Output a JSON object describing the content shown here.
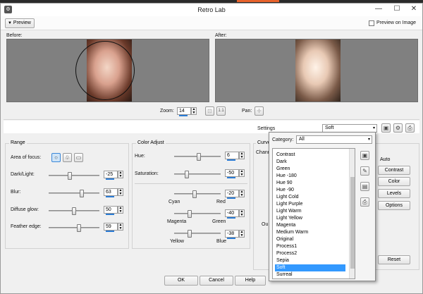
{
  "window": {
    "title": "Retro Lab",
    "app_label": "VZ",
    "close_glyph": "✕",
    "min_glyph": "—",
    "max_glyph": "☐"
  },
  "toolbar": {
    "preview_label": "Preview",
    "preview_on_image": "Preview on Image"
  },
  "preview": {
    "before_label": "Before:",
    "after_label": "After:",
    "zoom_label": "Zoom:",
    "zoom_value": "14",
    "pan_label": "Pan:"
  },
  "settings": {
    "label": "Settings",
    "value": "Soft"
  },
  "range": {
    "title": "Range",
    "area_of_focus": "Area of focus:",
    "rows": [
      {
        "label": "Dark/Light:",
        "value": "-25",
        "pos": 0.37
      },
      {
        "label": "Blur:",
        "value": "63",
        "pos": 0.78
      },
      {
        "label": "Diffuse glow:",
        "value": "50",
        "pos": 0.5
      },
      {
        "label": "Feather edge:",
        "value": "59",
        "pos": 0.6
      }
    ]
  },
  "color_adjust": {
    "title": "Color Adjust",
    "hue_label": "Hue:",
    "hue_value": "6",
    "hue_pos": 0.53,
    "sat_label": "Saturation:",
    "sat_value": "-50",
    "sat_pos": 0.25,
    "balance": [
      {
        "left": "Cyan",
        "right": "Red",
        "value": "-20",
        "pos": 0.4
      },
      {
        "left": "Magenta",
        "right": "Green",
        "value": "-40",
        "pos": 0.3
      },
      {
        "left": "Yellow",
        "right": "Blue",
        "value": "-38",
        "pos": 0.31
      }
    ]
  },
  "curves": {
    "title": "Curve",
    "channel_label": "Chann",
    "output_label": "Ou"
  },
  "auto": {
    "title": "Auto",
    "buttons": [
      "Contrast",
      "Color",
      "Levels",
      "Options"
    ],
    "reset": "Reset"
  },
  "dialog_buttons": {
    "ok": "OK",
    "cancel": "Cancel",
    "help": "Help"
  },
  "presets": {
    "category_label": "Category:",
    "category_value": "All",
    "items": [
      "Contrast",
      "Dark",
      "Green",
      "Hue -180",
      "Hue 90",
      "Hue -90",
      "Light Cold",
      "Light Purple",
      "Light Warm",
      "Light Yellow",
      "Magenta",
      "Medium Warm",
      "Original",
      "Process1",
      "Process2",
      "Sepia",
      "Soft",
      "Surreal"
    ],
    "selected": "Soft"
  }
}
